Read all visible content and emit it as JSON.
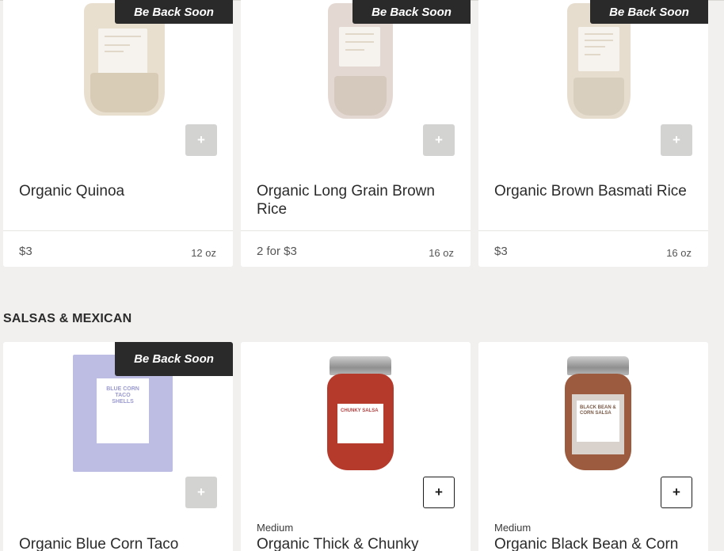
{
  "badge_text": "Be Back Soon",
  "add_symbol": "+",
  "top_products": [
    {
      "name": "Organic Quinoa",
      "price": "$3",
      "size": "12 oz",
      "badge": "Be Back Soon",
      "image_label": "QUINOA",
      "available": false
    },
    {
      "name": "Organic Long Grain Brown Rice",
      "price": "2 for $3",
      "size": "16 oz",
      "badge": "Be Back Soon",
      "image_label": "LONG GRAIN BROWN RICE",
      "available": false
    },
    {
      "name": "Organic Brown Basmati Rice",
      "price": "$3",
      "size": "16 oz",
      "badge": "Be Back Soon",
      "image_label": "BROWN BASMATI RICE",
      "available": false
    }
  ],
  "section": {
    "title": "SALSAS & MEXICAN"
  },
  "salsa_products": [
    {
      "name": "Organic Blue Corn Taco",
      "variant": "",
      "badge": "Be Back Soon",
      "image_label": "BLUE CORN TACO SHELLS",
      "available": false
    },
    {
      "name": "Organic Thick & Chunky",
      "variant": "Medium",
      "badge": "",
      "image_label": "CHUNKY SALSA",
      "available": true
    },
    {
      "name": "Organic Black Bean & Corn",
      "variant": "Medium",
      "badge": "",
      "image_label": "BLACK BEAN & CORN SALSA",
      "available": true
    }
  ],
  "colors": {
    "background": "#f1f0ee",
    "badge": "#2a2a2a",
    "button_disabled": "#d3d3d2",
    "quinoa_bag": "#e9dfcf",
    "rice_bag": "#e4d8d2",
    "basmati_bag": "#e6ddcf",
    "taco_box": "#bdbde4",
    "chunky_salsa": "#b63a2c",
    "black_bean_salsa": "#9c5a3e"
  }
}
